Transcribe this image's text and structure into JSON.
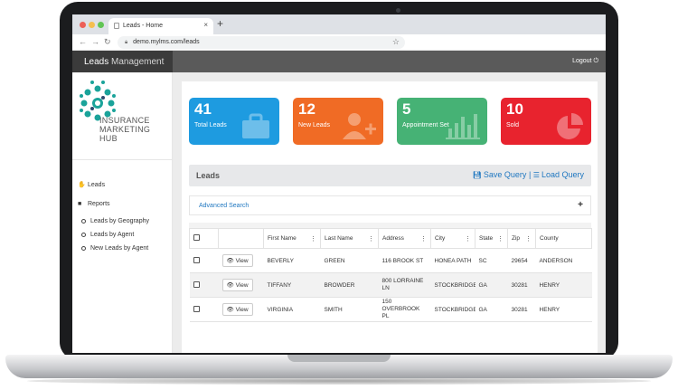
{
  "browser": {
    "tab_title": "Leads - Home",
    "tab_close": "×",
    "new_tab": "+",
    "url": "demo.mylms.com/leads"
  },
  "header": {
    "brand_bold": "Leads",
    "brand_light": "Management",
    "logout": "Logout"
  },
  "logo": {
    "line1": "INSURANCE",
    "line2": "MARKETING",
    "line3": "HUB"
  },
  "sidebar": {
    "leads": "Leads",
    "reports": "Reports",
    "sub": [
      "Leads by Geography",
      "Leads by Agent",
      "New Leads by Agent"
    ]
  },
  "cards": [
    {
      "value": "41",
      "label": "Total Leads",
      "color": "#1e9be0",
      "icon": "briefcase-icon"
    },
    {
      "value": "12",
      "label": "New Leads",
      "color": "#f06b25",
      "icon": "add-user-icon"
    },
    {
      "value": "5",
      "label": "Appointment Set",
      "color": "#46b275",
      "icon": "bar-chart-icon"
    },
    {
      "value": "10",
      "label": "Sold",
      "color": "#e8232e",
      "icon": "pie-chart-icon"
    }
  ],
  "leads_bar": {
    "title": "Leads",
    "save_query": "Save Query",
    "separator": "|",
    "load_query": "Load Query"
  },
  "advanced_search": {
    "label": "Advanced Search",
    "toggle": "+"
  },
  "table": {
    "columns": [
      "First Name",
      "Last Name",
      "Address",
      "City",
      "State",
      "Zip",
      "County"
    ],
    "view_label": "View",
    "rows": [
      {
        "first": "BEVERLY",
        "last": "GREEN",
        "address": "116 BROOK ST",
        "city": "HONEA PATH",
        "state": "SC",
        "zip": "29654",
        "county": "ANDERSON"
      },
      {
        "first": "TIFFANY",
        "last": "BROWDER",
        "address": "800 LORRAINE LN",
        "city": "STOCKBRIDGE",
        "state": "GA",
        "zip": "30281",
        "county": "HENRY"
      },
      {
        "first": "VIRGINIA",
        "last": "SMITH",
        "address": "150 OVERBROOK PL",
        "city": "STOCKBRIDGE",
        "state": "GA",
        "zip": "30281",
        "county": "HENRY"
      }
    ]
  }
}
